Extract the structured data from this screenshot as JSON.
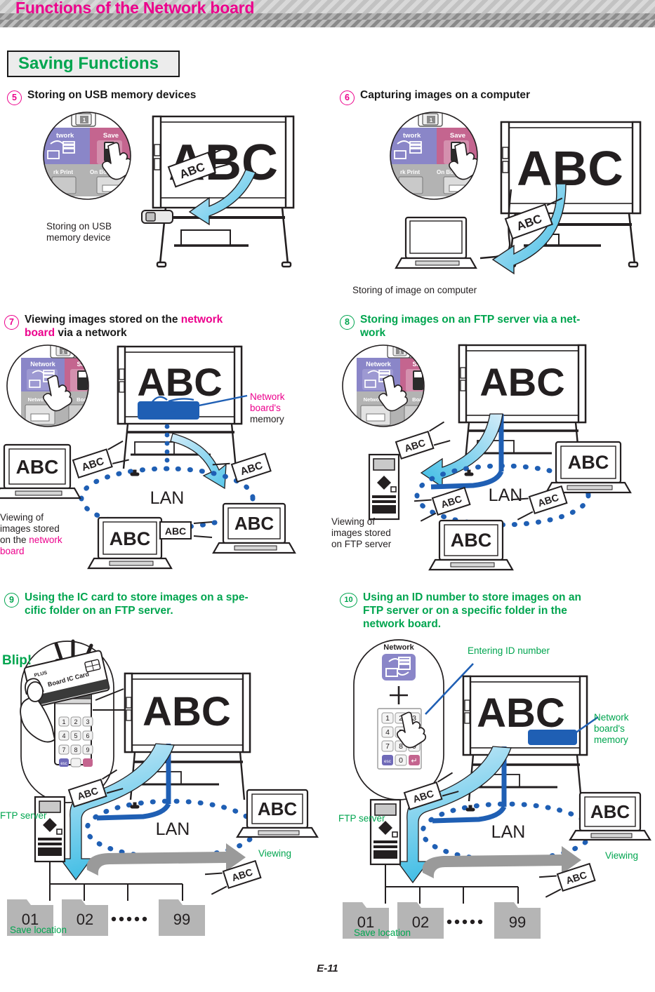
{
  "header": {
    "banner_title": "Functions of the Network board",
    "section_box_label": "Saving Functions"
  },
  "footer": {
    "page_number": "E-11"
  },
  "colors": {
    "magenta": "#ec008c",
    "green": "#00a54f",
    "panel_network": "#8a86c8",
    "panel_save": "#c4658f",
    "panel_gray": "#b3b3b3",
    "arrow_light_blue": "#4cc3e8",
    "lan_blue": "#1f5fb4",
    "folder_gray": "#b5b5b5"
  },
  "panel": {
    "network_label": "Network",
    "save_label": "Save",
    "network_print_label": "Network Print",
    "on_board_label": "On Board",
    "page_badge": "1"
  },
  "board": {
    "text": "ABC"
  },
  "keypad": {
    "network_label": "Network",
    "plus": "+",
    "keys": [
      "1",
      "2",
      "3",
      "4",
      "5",
      "6",
      "7",
      "8",
      "9"
    ],
    "esc": "esc",
    "zero": "0",
    "enter": "↵"
  },
  "ic_card": {
    "blip": "Blip!",
    "brand": "PLUS",
    "card_label": "Board IC Card",
    "keys": [
      "1",
      "2",
      "3",
      "4",
      "5",
      "6",
      "7",
      "8",
      "9"
    ],
    "esc": "esc"
  },
  "sections": [
    {
      "id": "5",
      "number": "⑤",
      "num_text": "5",
      "color": "magenta",
      "title_parts": [
        {
          "t": "Storing on USB memory devices",
          "c": "dark"
        }
      ],
      "caption": "Storing on USB\nmemory device",
      "caption_line1": "Storing on USB",
      "caption_line2": "memory device",
      "board_text": "ABC",
      "thumb_text": "ABC"
    },
    {
      "id": "6",
      "num_text": "6",
      "color": "magenta",
      "title_parts": [
        {
          "t": "Capturing images on a computer",
          "c": "dark"
        }
      ],
      "caption": "Storing of image on computer",
      "board_text": "ABC",
      "thumb_text": "ABC"
    },
    {
      "id": "7",
      "num_text": "7",
      "color": "magenta",
      "title_line1_a": "Viewing images stored on the ",
      "title_line1_b": "network",
      "title_line2_a": "board",
      "title_line2_b": " via a network",
      "callout_line1": "Network",
      "callout_line2": "board's",
      "callout_line3": "memory",
      "caption_l1": "Viewing of",
      "caption_l2": "images stored",
      "caption_l3a": "on the ",
      "caption_l3b": "network",
      "caption_l4": "board",
      "lan_label": "LAN",
      "board_text": "ABC",
      "node_text": "ABC"
    },
    {
      "id": "8",
      "num_text": "8",
      "color": "green",
      "title_line1": "Storing images on an FTP server via a net-",
      "title_line2": "work",
      "caption_l1": "Viewing of",
      "caption_l2": "images stored",
      "caption_l3": "on FTP server",
      "lan_label": "LAN",
      "board_text": "ABC",
      "node_text": "ABC"
    },
    {
      "id": "9",
      "num_text": "9",
      "color": "green",
      "title_line1": "Using the IC card to store images on a spe-",
      "title_line2": "cific folder on an FTP server.",
      "ftp_label": "FTP server",
      "viewing_label": "Viewing",
      "save_location_label": "Save location",
      "lan_label": "LAN",
      "board_text": "ABC",
      "folders": [
        "01",
        "02",
        "99"
      ],
      "folder_dots": "·········"
    },
    {
      "id": "10",
      "num_text": "10",
      "color": "green",
      "title_line1": "Using an ID number to store images on an",
      "title_line2": "FTP server or on a specific folder in the",
      "title_line3": "network board.",
      "entering_id_label": "Entering ID number",
      "memory_l1": "Network",
      "memory_l2": "board's",
      "memory_l3": "memory",
      "ftp_label": "FTP server",
      "viewing_label": "Viewing",
      "save_location_label": "Save location",
      "lan_label": "LAN",
      "board_text": "ABC",
      "folders": [
        "01",
        "02",
        "99"
      ],
      "folder_dots": "·········"
    }
  ]
}
